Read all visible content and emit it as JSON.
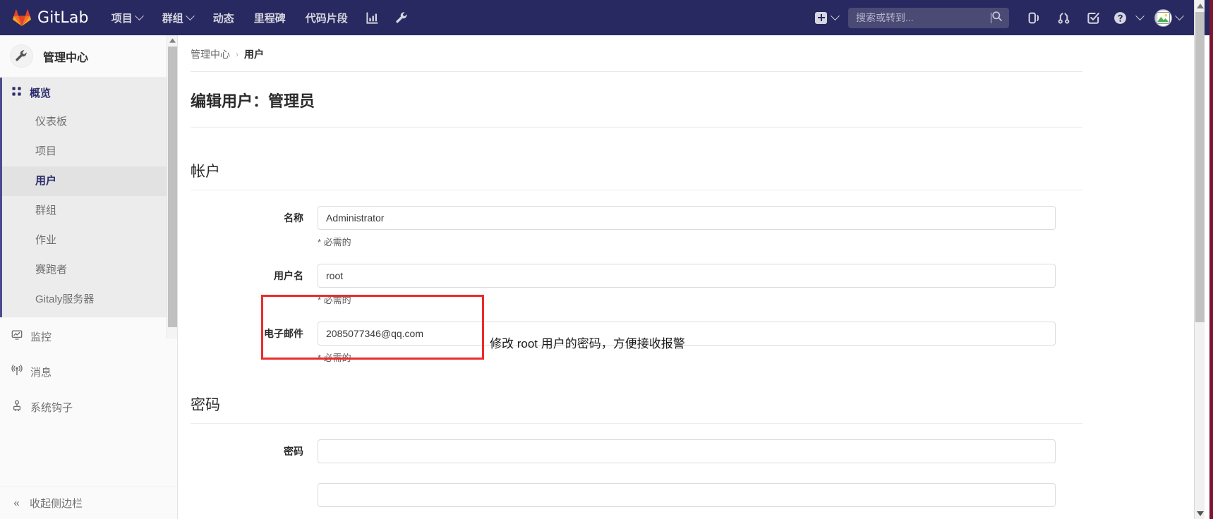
{
  "navbar": {
    "brand": "GitLab",
    "brand_icon": "gitlab-fox-logo",
    "items": [
      {
        "label": "项目",
        "icon": "chevron-down-icon",
        "has_chevron": true
      },
      {
        "label": "群组",
        "icon": "chevron-down-icon",
        "has_chevron": true
      },
      {
        "label": "动态",
        "has_chevron": false
      },
      {
        "label": "里程碑",
        "has_chevron": false
      },
      {
        "label": "代码片段",
        "has_chevron": false
      }
    ],
    "activity_icon": "analytics-chart-icon",
    "admin_icon": "wrench-icon",
    "create_new_icon": "plus-square-icon",
    "create_new_chevron": "chevron-down-icon",
    "search": {
      "placeholder": "搜索或转到...",
      "value": "",
      "icon": "search-icon"
    },
    "right_icons": [
      {
        "name": "issues-icon"
      },
      {
        "name": "merge-requests-icon"
      },
      {
        "name": "todos-done-icon"
      },
      {
        "name": "help-question-icon"
      }
    ],
    "avatar": {
      "name": "user-avatar-broken-image"
    },
    "avatar_chevron": "chevron-down-icon",
    "bg_color": "#292961",
    "search_bg": "#4a4a75"
  },
  "sidebar": {
    "header": {
      "title": "管理中心",
      "icon": "wrench-icon"
    },
    "overview": {
      "label": "概览",
      "icon": "grid-dots-icon"
    },
    "sub_items": [
      {
        "label": "仪表板",
        "active": false
      },
      {
        "label": "项目",
        "active": false
      },
      {
        "label": "用户",
        "active": true
      },
      {
        "label": "群组",
        "active": false
      },
      {
        "label": "作业",
        "active": false
      },
      {
        "label": "赛跑者",
        "active": false
      },
      {
        "label": "Gitaly服务器",
        "active": false
      }
    ],
    "lower_items": [
      {
        "label": "监控",
        "icon": "monitor-chart-icon"
      },
      {
        "label": "消息",
        "icon": "broadcast-antenna-icon"
      },
      {
        "label": "系统钩子",
        "icon": "system-hook-icon"
      }
    ],
    "collapse": {
      "label": "收起侧边栏",
      "icon": "double-chevron-left-icon"
    },
    "active_accent": "#4b4b8f"
  },
  "content": {
    "breadcrumb": {
      "root": "管理中心",
      "separator": "›",
      "current": "用户"
    },
    "page_title": "编辑用户：管理员",
    "sections": [
      {
        "heading": "帐户",
        "fields": [
          {
            "label": "名称",
            "value": "Administrator",
            "hint": "* 必需的",
            "type": "text"
          },
          {
            "label": "用户名",
            "value": "root",
            "hint": "* 必需的",
            "type": "text"
          },
          {
            "label": "电子邮件",
            "value": "2085077346@qq.com",
            "hint": "* 必需的",
            "type": "text",
            "highlighted": true
          }
        ]
      },
      {
        "heading": "密码",
        "fields": [
          {
            "label": "密码",
            "value": "",
            "hint": "",
            "type": "password"
          },
          {
            "label": "",
            "value": "",
            "hint": "",
            "type": "password"
          }
        ]
      }
    ]
  },
  "annotation": {
    "text": "修改 root 用户的密码，方便接收报警",
    "box_color": "#ec2b2b",
    "target": "电子邮件"
  },
  "scrollbars": {
    "page": {
      "up_arrow": "▲",
      "down_arrow": "▼"
    },
    "sidebar": {
      "up_arrow": "▲"
    }
  }
}
